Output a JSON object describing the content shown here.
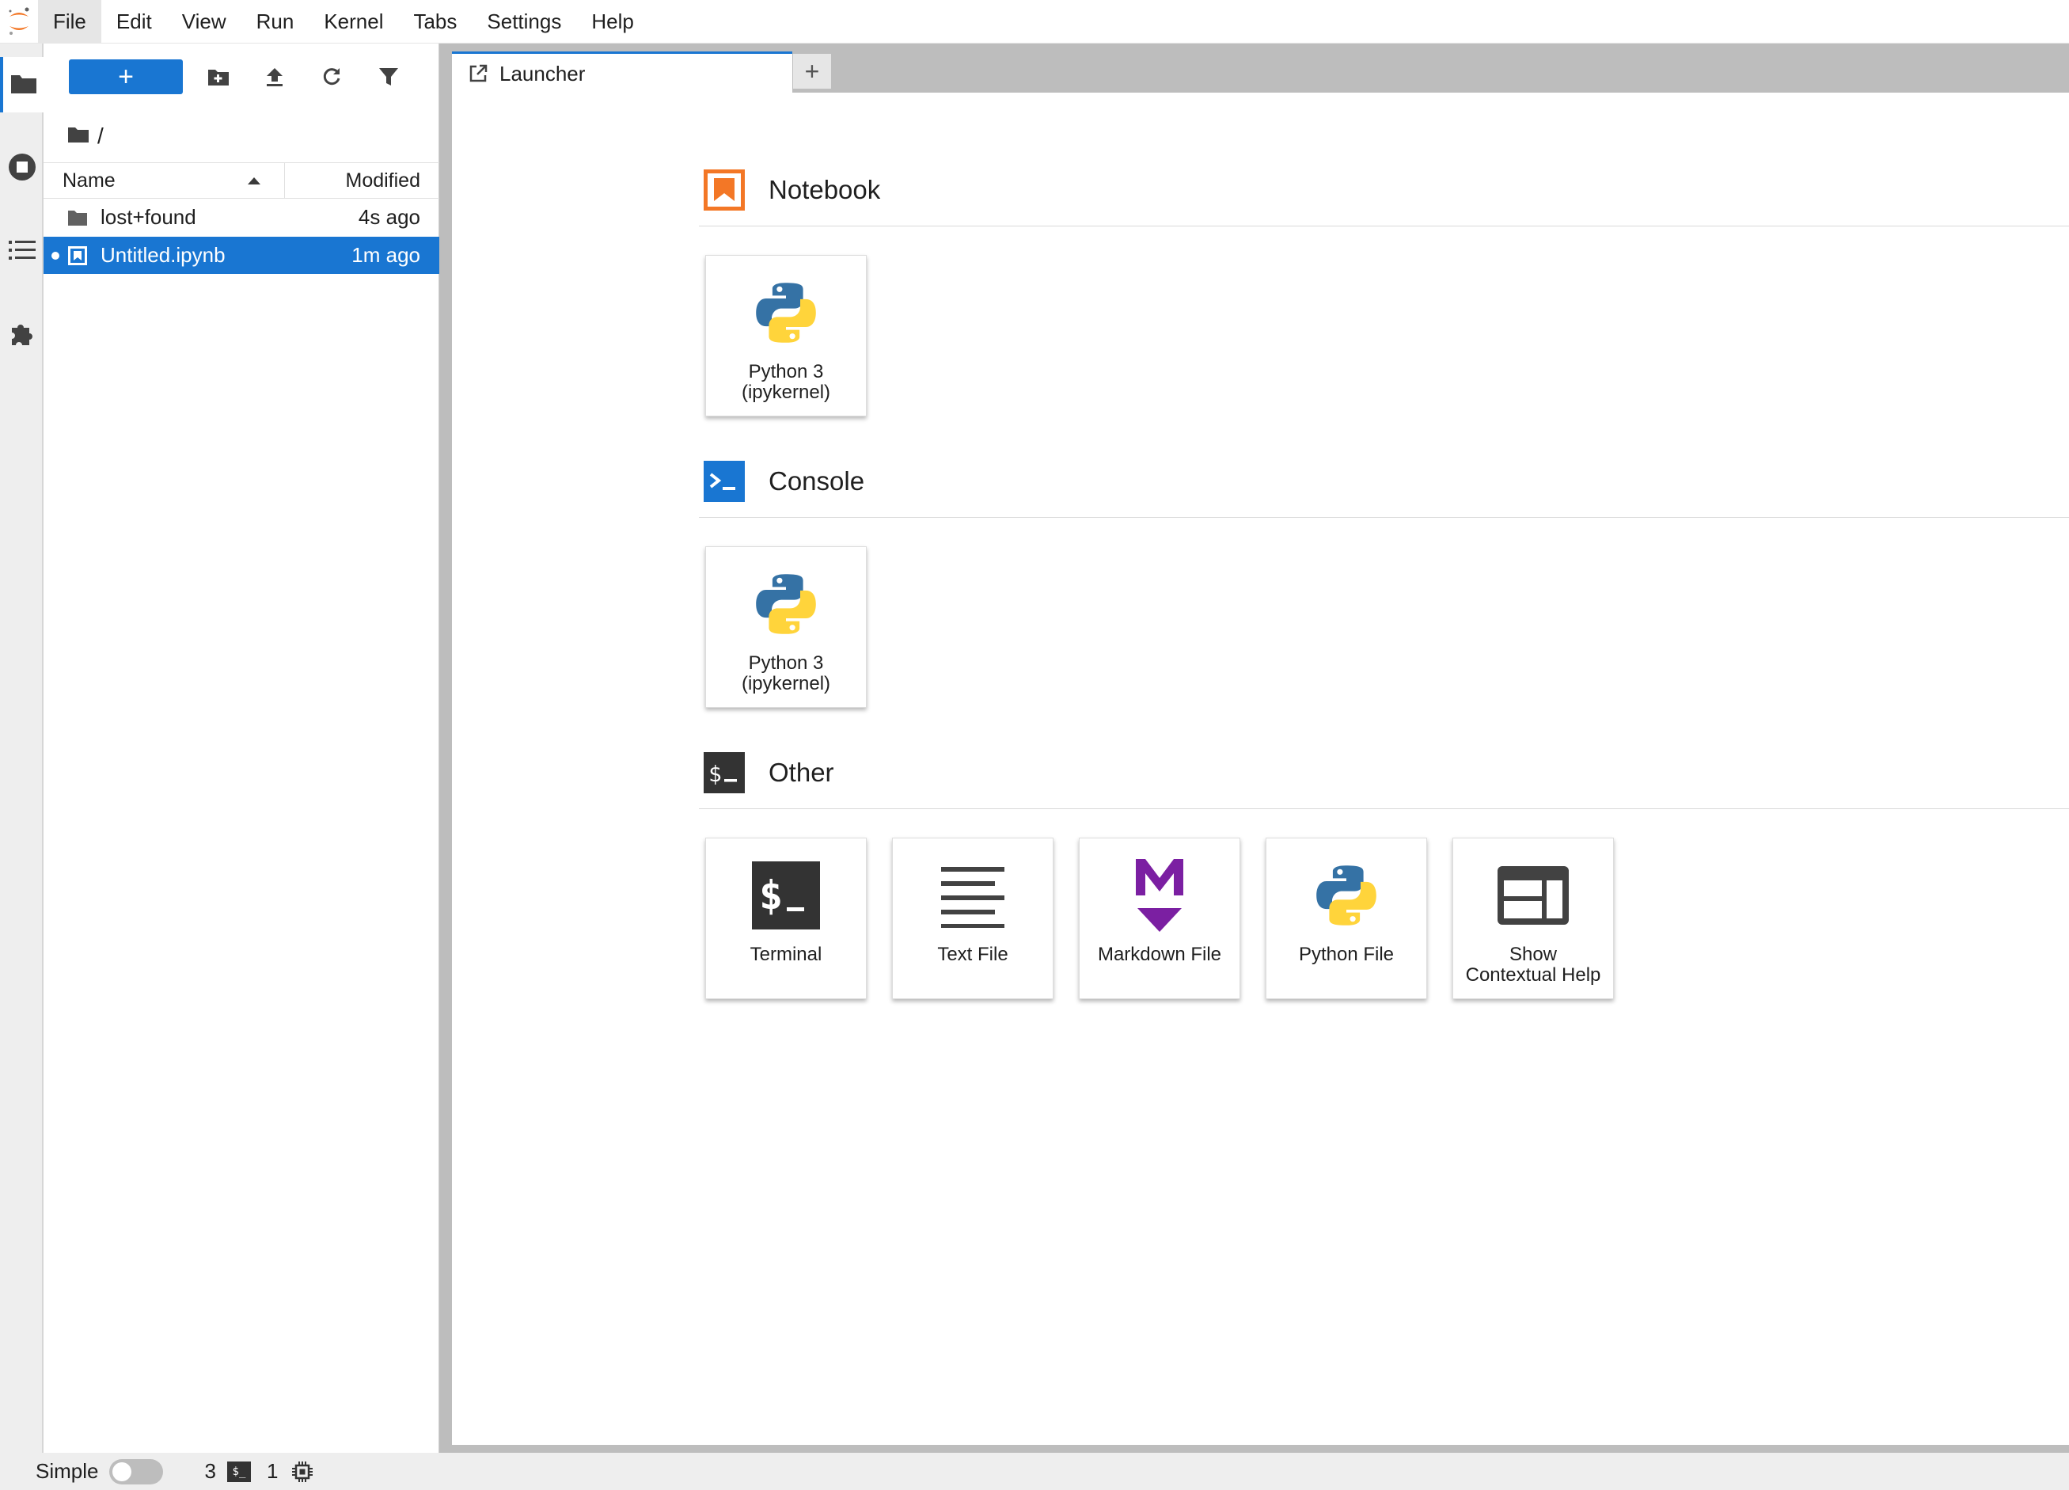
{
  "menu": {
    "items": [
      {
        "label": "File"
      },
      {
        "label": "Edit"
      },
      {
        "label": "View"
      },
      {
        "label": "Run"
      },
      {
        "label": "Kernel"
      },
      {
        "label": "Tabs"
      },
      {
        "label": "Settings"
      },
      {
        "label": "Help"
      }
    ],
    "active": "File"
  },
  "activity_bar": {
    "icons": [
      "folder-icon",
      "running-sessions-icon",
      "table-of-contents-icon",
      "extensions-icon"
    ],
    "active": "folder-icon"
  },
  "file_browser": {
    "new_button_label": "+",
    "toolbar_icons": [
      "new-folder-icon",
      "upload-icon",
      "refresh-icon",
      "filter-icon"
    ],
    "breadcrumb": "/",
    "columns": {
      "name": "Name",
      "modified": "Modified"
    },
    "sort": "name-ascending",
    "rows": [
      {
        "name": "lost+found",
        "modified": "4s ago",
        "type": "folder",
        "selected": false,
        "running": false
      },
      {
        "name": "Untitled.ipynb",
        "modified": "1m ago",
        "type": "notebook",
        "selected": true,
        "running": true
      }
    ]
  },
  "tabs": [
    {
      "label": "Launcher",
      "icon": "launcher-icon",
      "active": true
    }
  ],
  "tab_add_label": "+",
  "launcher": {
    "sections": [
      {
        "title": "Notebook",
        "icon": "notebook-icon",
        "cards": [
          {
            "label": "Python 3\n(ipykernel)",
            "icon": "python-logo-icon"
          }
        ]
      },
      {
        "title": "Console",
        "icon": "console-icon",
        "cards": [
          {
            "label": "Python 3\n(ipykernel)",
            "icon": "python-logo-icon"
          }
        ]
      },
      {
        "title": "Other",
        "icon": "terminal-icon",
        "cards": [
          {
            "label": "Terminal",
            "icon": "terminal-icon"
          },
          {
            "label": "Text File",
            "icon": "text-file-icon"
          },
          {
            "label": "Markdown File",
            "icon": "markdown-icon"
          },
          {
            "label": "Python File",
            "icon": "python-logo-icon"
          },
          {
            "label": "Show\nContextual Help",
            "icon": "contextual-help-icon"
          }
        ]
      }
    ]
  },
  "status_bar": {
    "mode_label": "Simple",
    "simple_mode_enabled": false,
    "terminals_count": "3",
    "terminal_glyph": "$_",
    "kernels_count": "1"
  },
  "colors": {
    "accent": "#1976d2",
    "notebook_orange": "#f37726",
    "markdown_purple": "#7b1fa2",
    "python_blue": "#3572a5",
    "python_yellow": "#ffd43b",
    "dark_icon": "#333333"
  }
}
